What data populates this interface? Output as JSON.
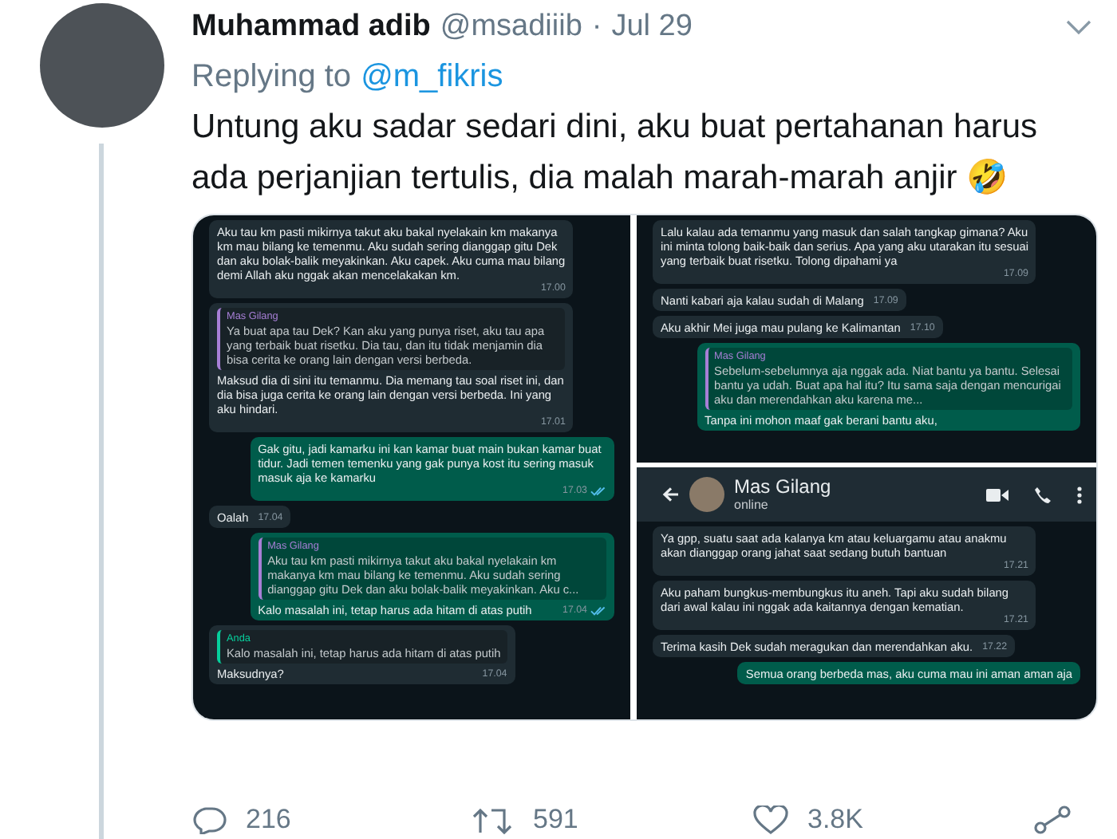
{
  "tweet": {
    "author_name": "Muhammad adib",
    "handle": "@msadiiib",
    "separator": "·",
    "date": "Jul 29",
    "replying_label": "Replying to",
    "reply_to": "@m_fikris",
    "text": "Untung aku sadar sedari dini, aku buat pertahanan harus ada perjanjian tertulis, dia malah marah-marah anjir 🤣"
  },
  "attached_screenshots": [
    {
      "messages": [
        {
          "kind": "incoming",
          "text": "Aku tau km pasti mikirnya takut aku bakal nyelakain km makanya km mau bilang ke temenmu. Aku sudah sering dianggap gitu Dek dan aku bolak-balik meyakinkan. Aku capek. Aku cuma mau bilang demi Allah aku nggak akan mencelakakan km.",
          "time": "17.00"
        },
        {
          "kind": "incoming",
          "quote": {
            "author": "Mas Gilang",
            "color": "#a77fd6",
            "text": "Ya buat apa tau Dek? Kan aku yang punya riset, aku tau apa yang terbaik buat risetku. Dia tau, dan itu tidak menjamin dia bisa cerita ke orang lain dengan versi berbeda."
          },
          "text": "Maksud dia di sini itu temanmu. Dia memang tau soal riset ini, dan dia bisa juga cerita ke orang lain dengan versi berbeda. Ini yang aku hindari.",
          "time": "17.01"
        },
        {
          "kind": "outgoing",
          "text": "Gak gitu, jadi kamarku ini kan kamar buat main bukan kamar buat tidur. Jadi temen temenku yang gak punya kost itu sering masuk masuk aja ke kamarku",
          "time": "17.03",
          "read": true
        },
        {
          "kind": "incoming",
          "text": "Oalah",
          "time": "17.04"
        },
        {
          "kind": "outgoing",
          "quote": {
            "author": "Mas Gilang",
            "color": "#a77fd6",
            "text": "Aku tau km pasti mikirnya takut aku bakal nyelakain km makanya km mau bilang ke temenmu. Aku sudah sering dianggap gitu Dek dan aku bolak-balik meyakinkan. Aku c..."
          },
          "text": "Kalo masalah ini, tetap harus ada hitam di atas putih",
          "time": "17.04",
          "read": true
        },
        {
          "kind": "incoming",
          "quote": {
            "author": "Anda",
            "color": "#06cf9c",
            "text": "Kalo masalah ini, tetap harus ada hitam di atas putih"
          },
          "text": "Maksudnya?",
          "time": "17.04"
        }
      ]
    },
    {
      "messages": [
        {
          "kind": "incoming",
          "text": "Lalu kalau ada temanmu yang masuk dan salah tangkap gimana? Aku ini minta tolong baik-baik dan serius. Apa yang aku utarakan itu sesuai yang terbaik buat risetku. Tolong dipahami ya",
          "time": "17.09"
        },
        {
          "kind": "incoming",
          "text": "Nanti kabari aja kalau sudah di Malang",
          "time": "17.09"
        },
        {
          "kind": "incoming",
          "text": "Aku akhir Mei juga mau pulang ke Kalimantan",
          "time": "17.10"
        },
        {
          "kind": "outgoing",
          "quote": {
            "author": "Mas Gilang",
            "color": "#a77fd6",
            "text": "Sebelum-sebelumnya aja nggak ada. Niat bantu ya bantu. Selesai bantu ya udah. Buat apa hal itu? Itu sama saja dengan mencurigai aku dan merendahkan aku karena me..."
          },
          "text": "Tanpa ini mohon maaf gak berani bantu aku,"
        }
      ]
    },
    {
      "header": {
        "name": "Mas Gilang",
        "status": "online"
      },
      "messages": [
        {
          "kind": "incoming",
          "text": "Ya gpp, suatu saat ada kalanya km atau keluargamu atau anakmu akan dianggap orang jahat saat sedang butuh bantuan",
          "time": "17.21"
        },
        {
          "kind": "incoming",
          "text": "Aku paham bungkus-membungkus itu aneh. Tapi aku sudah bilang dari awal kalau ini nggak ada kaitannya dengan kematian.",
          "time": "17.21"
        },
        {
          "kind": "incoming",
          "text": "Terima kasih Dek sudah meragukan dan merendahkan aku.",
          "time": "17.22"
        },
        {
          "kind": "outgoing",
          "text": "Semua orang berbeda mas, aku cuma mau ini aman aman aja"
        }
      ]
    }
  ],
  "actions": [
    {
      "kind": "reply",
      "count": "216"
    },
    {
      "kind": "retweet",
      "count": "591"
    },
    {
      "kind": "like",
      "count": "3.8K"
    },
    {
      "kind": "share"
    }
  ]
}
